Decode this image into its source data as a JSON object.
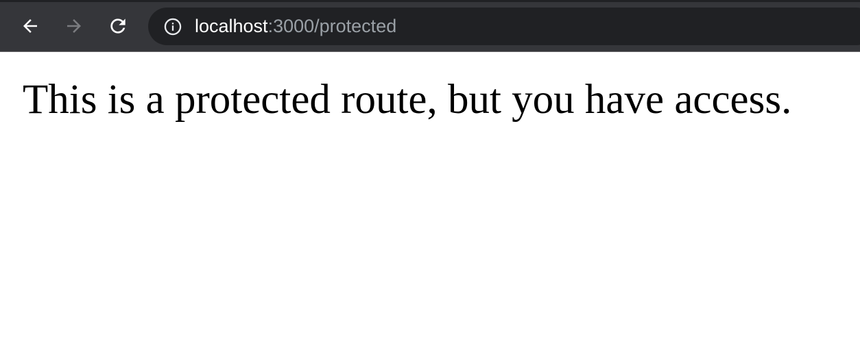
{
  "browser": {
    "address_bar": {
      "host": "localhost",
      "rest": ":3000/protected"
    },
    "icons": {
      "back": "arrow-left",
      "forward": "arrow-right",
      "reload": "reload",
      "info": "info-circle"
    }
  },
  "page": {
    "message": "This is a protected route, but you have access."
  },
  "colors": {
    "toolbar": "#35363a",
    "omnibox": "#202124",
    "url_host": "#ffffff",
    "url_rest": "#9aa0a6",
    "forward_disabled": "#7b7c80",
    "page_background": "#ffffff",
    "text": "#000000"
  }
}
